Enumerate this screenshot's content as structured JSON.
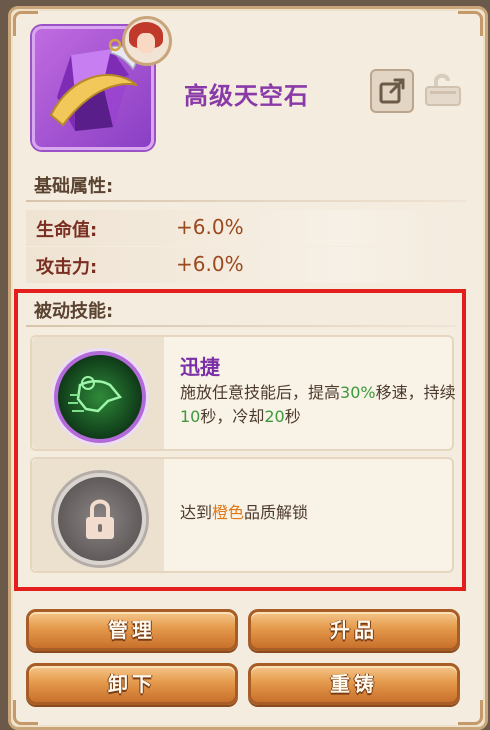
{
  "item": {
    "name": "高级天空石",
    "rarity_color": "#a24fd0"
  },
  "icons": {
    "share": "share-icon",
    "lock": "unlock-icon"
  },
  "base_attributes": {
    "title": "基础属性:",
    "rows": [
      {
        "label": "生命值:",
        "value": "+6.0%"
      },
      {
        "label": "攻击力:",
        "value": "+6.0%"
      }
    ]
  },
  "passive_skills": {
    "title": "被动技能:",
    "skills": [
      {
        "name": "迅捷",
        "desc_parts": [
          "施放任意技能后，提高",
          "30%",
          "移速，持续",
          "10",
          "秒，冷却",
          "20",
          "秒"
        ],
        "icon": "running-figure-icon"
      },
      {
        "locked": true,
        "desc_parts": [
          "达到",
          "橙色",
          "品质解锁"
        ],
        "icon": "padlock-icon"
      }
    ]
  },
  "buttons": {
    "manage": "管理",
    "upgrade": "升品",
    "unequip": "卸下",
    "reforge": "重铸"
  },
  "colors": {
    "highlight_green": "#3c9a3c",
    "highlight_orange": "#e07a18",
    "selection_box": "#e41e1e"
  }
}
